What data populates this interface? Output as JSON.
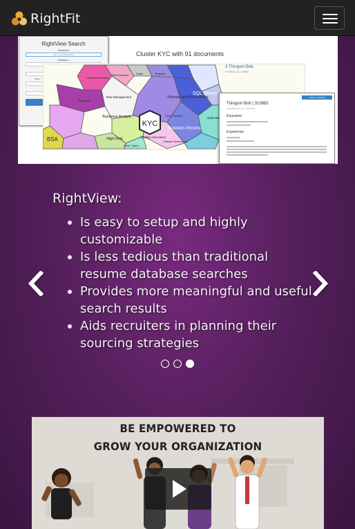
{
  "navbar": {
    "brand": "RightFit",
    "logo_icon": "rightfit-logo-icon",
    "menu_icon": "hamburger-menu-icon"
  },
  "slide_image": {
    "search_panel": {
      "title": "RightView Search",
      "fields": [
        "Keywords:",
        "Employer:",
        "Title:"
      ],
      "keyword_value": "kyc,money laundering",
      "row_labels": [
        "State:",
        "Zip Code:",
        "Radius (miles):"
      ],
      "date_label": "Resume Created Date:",
      "search_button": "Search"
    },
    "cluster_title": "Cluster KYC with 91 documents",
    "cluster_cells": [
      "KYC",
      "Policies and Procedures",
      "SQL Server",
      "Business Analyst",
      "Business Process",
      "BSA",
      "High Risk",
      "Risk Management",
      "Data Warehouse",
      "Quality Assurance",
      "Wire Transfer",
      "Web Services",
      "Other Topics",
      "Projects",
      "Sales",
      "Software Development",
      "Global Procedures",
      "Prepared"
    ],
    "side_link": "3 Thingum Bob",
    "side_meta": "KYCBOB-02 / 313882",
    "resume_card": {
      "button": "Include in shortlist",
      "name": "Thingum Bob | 313882",
      "sub": "bob@fakemail.com - 555-0100",
      "sections": [
        "Education",
        "Experience"
      ]
    }
  },
  "caption": {
    "heading": "RightView:",
    "items": [
      "Is easy to setup and highly customizable",
      "Is less tedious than traditional resume database searches",
      "Provides more meaningful and useful search results",
      "Aids recruiters in planning their sourcing strategies"
    ]
  },
  "carousel": {
    "prev_icon": "chevron-left-icon",
    "next_icon": "chevron-right-icon",
    "slide_count": 3,
    "active_index": 2
  },
  "video": {
    "title_line_1": "BE EMPOWERED TO",
    "title_line_2": "GROW YOUR ORGANIZATION",
    "play_icon": "play-icon"
  },
  "colors": {
    "navbar_bg": "#222222",
    "page_bg": "#56205d",
    "search_button": "#3b7fc4"
  }
}
